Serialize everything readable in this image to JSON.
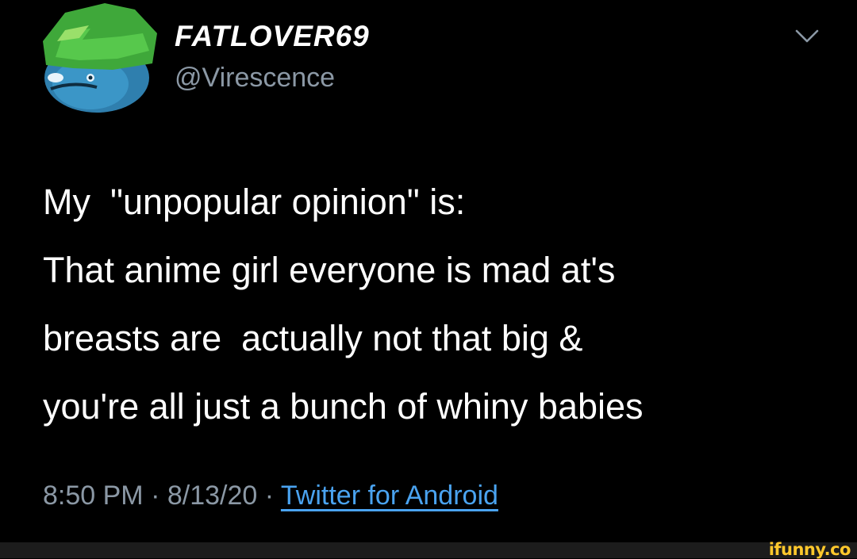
{
  "tweet": {
    "display_name": "FATLOVER69",
    "handle": "@Virescence",
    "text_lines": [
      "My  \"unpopular opinion\" is:",
      "That anime girl everyone is mad at's",
      "breasts are  actually not that big &",
      "you're all just a bunch of whiny babies"
    ],
    "time": "8:50 PM",
    "separator": " · ",
    "date": "8/13/20",
    "source": "Twitter for Android"
  },
  "watermark": "ifunny.co",
  "icons": {
    "avatar": "avatar-image",
    "menu": "chevron-down-icon"
  },
  "colors": {
    "background": "#000000",
    "text": "#ffffff",
    "secondary": "#8b98a5",
    "link": "#4aa3f0",
    "watermark": "#ffc82c"
  }
}
